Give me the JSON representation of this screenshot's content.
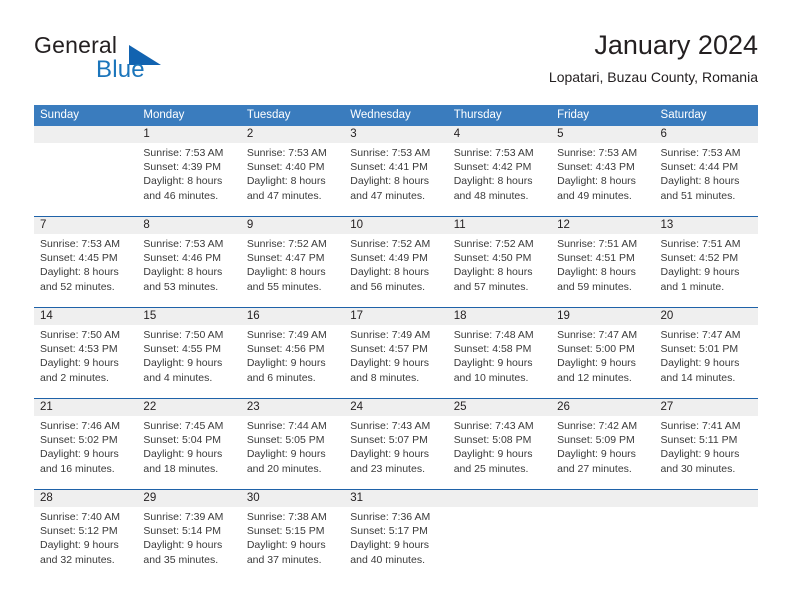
{
  "brand": {
    "name_part1": "General",
    "name_part2": "Blue",
    "triangle_color": "#1263b0",
    "blue_color": "#1b75bb"
  },
  "header": {
    "title": "January 2024",
    "subtitle": "Lopatari, Buzau County, Romania"
  },
  "theme": {
    "header_band": "#3a7cbe",
    "row_divider": "#1f62a8",
    "daynum_strip": "#efefef"
  },
  "weekdays": [
    "Sunday",
    "Monday",
    "Tuesday",
    "Wednesday",
    "Thursday",
    "Friday",
    "Saturday"
  ],
  "weeks": [
    {
      "days": [
        {
          "num": "",
          "sunrise": "",
          "sunset": "",
          "daylight": ""
        },
        {
          "num": "1",
          "sunrise": "Sunrise: 7:53 AM",
          "sunset": "Sunset: 4:39 PM",
          "daylight": "Daylight: 8 hours and 46 minutes."
        },
        {
          "num": "2",
          "sunrise": "Sunrise: 7:53 AM",
          "sunset": "Sunset: 4:40 PM",
          "daylight": "Daylight: 8 hours and 47 minutes."
        },
        {
          "num": "3",
          "sunrise": "Sunrise: 7:53 AM",
          "sunset": "Sunset: 4:41 PM",
          "daylight": "Daylight: 8 hours and 47 minutes."
        },
        {
          "num": "4",
          "sunrise": "Sunrise: 7:53 AM",
          "sunset": "Sunset: 4:42 PM",
          "daylight": "Daylight: 8 hours and 48 minutes."
        },
        {
          "num": "5",
          "sunrise": "Sunrise: 7:53 AM",
          "sunset": "Sunset: 4:43 PM",
          "daylight": "Daylight: 8 hours and 49 minutes."
        },
        {
          "num": "6",
          "sunrise": "Sunrise: 7:53 AM",
          "sunset": "Sunset: 4:44 PM",
          "daylight": "Daylight: 8 hours and 51 minutes."
        }
      ]
    },
    {
      "days": [
        {
          "num": "7",
          "sunrise": "Sunrise: 7:53 AM",
          "sunset": "Sunset: 4:45 PM",
          "daylight": "Daylight: 8 hours and 52 minutes."
        },
        {
          "num": "8",
          "sunrise": "Sunrise: 7:53 AM",
          "sunset": "Sunset: 4:46 PM",
          "daylight": "Daylight: 8 hours and 53 minutes."
        },
        {
          "num": "9",
          "sunrise": "Sunrise: 7:52 AM",
          "sunset": "Sunset: 4:47 PM",
          "daylight": "Daylight: 8 hours and 55 minutes."
        },
        {
          "num": "10",
          "sunrise": "Sunrise: 7:52 AM",
          "sunset": "Sunset: 4:49 PM",
          "daylight": "Daylight: 8 hours and 56 minutes."
        },
        {
          "num": "11",
          "sunrise": "Sunrise: 7:52 AM",
          "sunset": "Sunset: 4:50 PM",
          "daylight": "Daylight: 8 hours and 57 minutes."
        },
        {
          "num": "12",
          "sunrise": "Sunrise: 7:51 AM",
          "sunset": "Sunset: 4:51 PM",
          "daylight": "Daylight: 8 hours and 59 minutes."
        },
        {
          "num": "13",
          "sunrise": "Sunrise: 7:51 AM",
          "sunset": "Sunset: 4:52 PM",
          "daylight": "Daylight: 9 hours and 1 minute."
        }
      ]
    },
    {
      "days": [
        {
          "num": "14",
          "sunrise": "Sunrise: 7:50 AM",
          "sunset": "Sunset: 4:53 PM",
          "daylight": "Daylight: 9 hours and 2 minutes."
        },
        {
          "num": "15",
          "sunrise": "Sunrise: 7:50 AM",
          "sunset": "Sunset: 4:55 PM",
          "daylight": "Daylight: 9 hours and 4 minutes."
        },
        {
          "num": "16",
          "sunrise": "Sunrise: 7:49 AM",
          "sunset": "Sunset: 4:56 PM",
          "daylight": "Daylight: 9 hours and 6 minutes."
        },
        {
          "num": "17",
          "sunrise": "Sunrise: 7:49 AM",
          "sunset": "Sunset: 4:57 PM",
          "daylight": "Daylight: 9 hours and 8 minutes."
        },
        {
          "num": "18",
          "sunrise": "Sunrise: 7:48 AM",
          "sunset": "Sunset: 4:58 PM",
          "daylight": "Daylight: 9 hours and 10 minutes."
        },
        {
          "num": "19",
          "sunrise": "Sunrise: 7:47 AM",
          "sunset": "Sunset: 5:00 PM",
          "daylight": "Daylight: 9 hours and 12 minutes."
        },
        {
          "num": "20",
          "sunrise": "Sunrise: 7:47 AM",
          "sunset": "Sunset: 5:01 PM",
          "daylight": "Daylight: 9 hours and 14 minutes."
        }
      ]
    },
    {
      "days": [
        {
          "num": "21",
          "sunrise": "Sunrise: 7:46 AM",
          "sunset": "Sunset: 5:02 PM",
          "daylight": "Daylight: 9 hours and 16 minutes."
        },
        {
          "num": "22",
          "sunrise": "Sunrise: 7:45 AM",
          "sunset": "Sunset: 5:04 PM",
          "daylight": "Daylight: 9 hours and 18 minutes."
        },
        {
          "num": "23",
          "sunrise": "Sunrise: 7:44 AM",
          "sunset": "Sunset: 5:05 PM",
          "daylight": "Daylight: 9 hours and 20 minutes."
        },
        {
          "num": "24",
          "sunrise": "Sunrise: 7:43 AM",
          "sunset": "Sunset: 5:07 PM",
          "daylight": "Daylight: 9 hours and 23 minutes."
        },
        {
          "num": "25",
          "sunrise": "Sunrise: 7:43 AM",
          "sunset": "Sunset: 5:08 PM",
          "daylight": "Daylight: 9 hours and 25 minutes."
        },
        {
          "num": "26",
          "sunrise": "Sunrise: 7:42 AM",
          "sunset": "Sunset: 5:09 PM",
          "daylight": "Daylight: 9 hours and 27 minutes."
        },
        {
          "num": "27",
          "sunrise": "Sunrise: 7:41 AM",
          "sunset": "Sunset: 5:11 PM",
          "daylight": "Daylight: 9 hours and 30 minutes."
        }
      ]
    },
    {
      "days": [
        {
          "num": "28",
          "sunrise": "Sunrise: 7:40 AM",
          "sunset": "Sunset: 5:12 PM",
          "daylight": "Daylight: 9 hours and 32 minutes."
        },
        {
          "num": "29",
          "sunrise": "Sunrise: 7:39 AM",
          "sunset": "Sunset: 5:14 PM",
          "daylight": "Daylight: 9 hours and 35 minutes."
        },
        {
          "num": "30",
          "sunrise": "Sunrise: 7:38 AM",
          "sunset": "Sunset: 5:15 PM",
          "daylight": "Daylight: 9 hours and 37 minutes."
        },
        {
          "num": "31",
          "sunrise": "Sunrise: 7:36 AM",
          "sunset": "Sunset: 5:17 PM",
          "daylight": "Daylight: 9 hours and 40 minutes."
        },
        {
          "num": "",
          "sunrise": "",
          "sunset": "",
          "daylight": ""
        },
        {
          "num": "",
          "sunrise": "",
          "sunset": "",
          "daylight": ""
        },
        {
          "num": "",
          "sunrise": "",
          "sunset": "",
          "daylight": ""
        }
      ]
    }
  ]
}
